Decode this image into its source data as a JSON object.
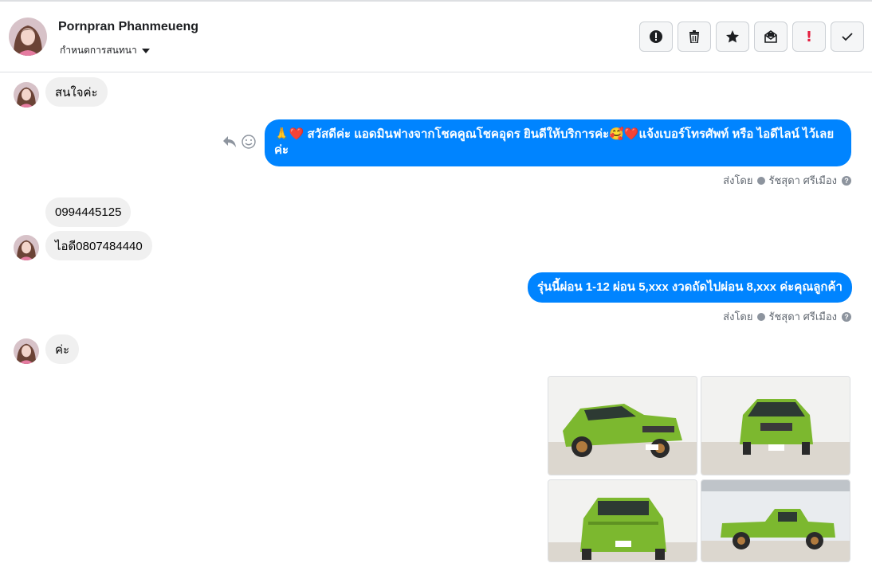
{
  "header": {
    "contact_name": "Pornpran Phanmeueng",
    "conversation_settings_label": "กำหนดการสนทนา",
    "toolbar": [
      {
        "icon": "alert-circle-icon"
      },
      {
        "icon": "trash-icon"
      },
      {
        "icon": "star-icon"
      },
      {
        "icon": "mark-unread-icon"
      },
      {
        "icon": "important-exclamation-icon"
      },
      {
        "icon": "done-check-icon"
      }
    ]
  },
  "messages": {
    "m1": "สนใจค่ะ",
    "m2": "🙏❤️ สวัสดีค่ะ แอดมินฟางจากโชคคูณโชคอุดร ยินดีให้บริการค่ะ🥰❤️แจ้งเบอร์โทรศัพท์ หรือ ไอดีไลน์  ไว้เลยค่ะ",
    "m3": "0994445125",
    "m4": "ไอดี0807484440",
    "m5": "รุ่นนี้ผ่อน 1-12 ผ่อน 5,xxx งวดถัดไปผ่อน 8,xxx ค่ะคุณลูกค้า",
    "m6": "ค่ะ"
  },
  "sent_by": {
    "label": "ส่งโดย",
    "agent": "รัชสุดา ศรีเมือง"
  },
  "colors": {
    "outgoing_bubble": "#0084ff",
    "incoming_bubble": "#f0f0f0",
    "car_green": "#7cb82f"
  }
}
